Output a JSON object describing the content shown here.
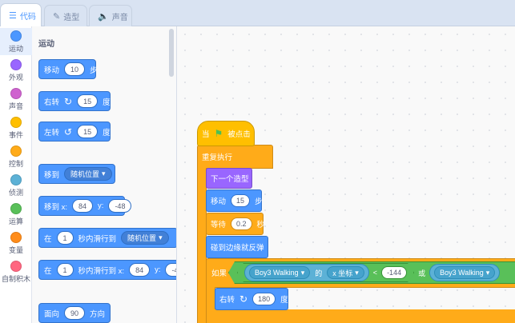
{
  "tabs": [
    {
      "label": "代码",
      "icon": "code-icon",
      "active": true
    },
    {
      "label": "造型",
      "icon": "brush-icon",
      "active": false
    },
    {
      "label": "声音",
      "icon": "speaker-icon",
      "active": false
    }
  ],
  "categories": [
    {
      "label": "运动",
      "color": "#4c97ff"
    },
    {
      "label": "外观",
      "color": "#9966ff"
    },
    {
      "label": "声音",
      "color": "#cf63cf"
    },
    {
      "label": "事件",
      "color": "#ffbf00"
    },
    {
      "label": "控制",
      "color": "#ffab19"
    },
    {
      "label": "侦测",
      "color": "#5cb1d6"
    },
    {
      "label": "运算",
      "color": "#59c059"
    },
    {
      "label": "变量",
      "color": "#ff8c1a"
    },
    {
      "label": "自制积木",
      "color": "#ff6680"
    }
  ],
  "palette": {
    "title": "运动",
    "move": {
      "label": "移动",
      "value": "10",
      "unit": "步"
    },
    "turn_right": {
      "label": "右转",
      "value": "15",
      "unit": "度"
    },
    "turn_left": {
      "label": "左转",
      "value": "15",
      "unit": "度"
    },
    "goto": {
      "label": "移到",
      "target": "随机位置"
    },
    "goto_xy": {
      "label": "移到 x:",
      "x": "84",
      "ylabel": "y:",
      "y": "-48"
    },
    "glide": {
      "prefix": "在",
      "secs": "1",
      "label": "秒内滑行到",
      "target": "随机位置"
    },
    "glide_xy": {
      "prefix": "在",
      "secs": "1",
      "label": "秒内滑行到 x:",
      "x": "84",
      "ylabel": "y:",
      "y": "-4"
    },
    "point": {
      "label": "面向",
      "value": "90",
      "unit": "方向"
    }
  },
  "script": {
    "hat": {
      "prefix": "当",
      "suffix": "被点击"
    },
    "forever": "重复执行",
    "next_costume": "下一个造型",
    "move": {
      "label": "移动",
      "value": "15",
      "unit": "步"
    },
    "wait": {
      "label": "等待",
      "value": "0.2",
      "unit": "秒"
    },
    "bounce": "碰到边缘就反弹",
    "if": {
      "label": "如果",
      "sprite": "Boy3 Walking",
      "of": "的",
      "attr": "x 坐标",
      "op": "<",
      "value": "-144",
      "or": "或",
      "sprite2": "Boy3 Walking"
    },
    "turn": {
      "label": "右转",
      "value": "180",
      "unit": "度"
    }
  }
}
